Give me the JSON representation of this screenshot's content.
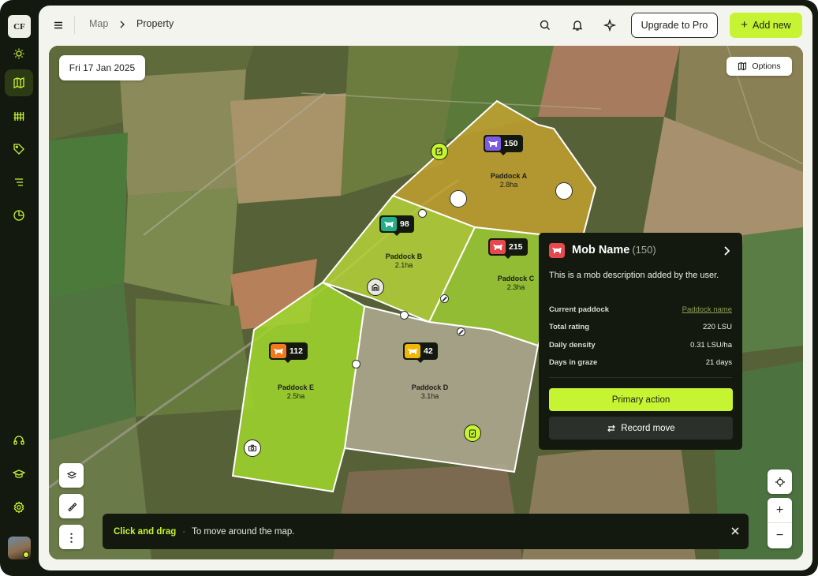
{
  "app": {
    "logo_text": "CF"
  },
  "sidebar": {
    "items": [
      {
        "name": "weather",
        "icon": "sun-icon"
      },
      {
        "name": "map",
        "icon": "map-icon",
        "active": true
      },
      {
        "name": "paddocks",
        "icon": "fence-icon"
      },
      {
        "name": "tags",
        "icon": "tag-icon"
      },
      {
        "name": "tasks",
        "icon": "list-icon"
      },
      {
        "name": "reports",
        "icon": "pie-chart-icon"
      },
      {
        "name": "support",
        "icon": "headset-icon"
      },
      {
        "name": "learn",
        "icon": "graduation-cap-icon"
      },
      {
        "name": "settings",
        "icon": "gear-icon"
      }
    ]
  },
  "header": {
    "breadcrumb": [
      "Map",
      "Property"
    ],
    "upgrade_label": "Upgrade to Pro",
    "add_label": "Add new",
    "icons": [
      "menu-icon",
      "search-icon",
      "bell-icon",
      "sparkle-icon"
    ]
  },
  "map": {
    "date": "Fri 17 Jan 2025",
    "options_label": "Options",
    "paddocks": [
      {
        "name": "Paddock A",
        "area": "2.8ha"
      },
      {
        "name": "Paddock B",
        "area": "2.1ha"
      },
      {
        "name": "Paddock C",
        "area": "2.3ha"
      },
      {
        "name": "Paddock D",
        "area": "3.1ha"
      },
      {
        "name": "Paddock E",
        "area": "2.5ha"
      }
    ],
    "mobs": [
      {
        "count": "150",
        "color": "#7c5ce0"
      },
      {
        "count": "98",
        "color": "#1fb08a"
      },
      {
        "count": "215",
        "color": "#e5484d"
      },
      {
        "count": "112",
        "color": "#f07a1c"
      },
      {
        "count": "42",
        "color": "#f2b705"
      }
    ]
  },
  "mob_panel": {
    "title": "Mob Name",
    "count": "(150)",
    "description": "This is a mob description added by the user.",
    "rows": [
      {
        "label": "Current paddock",
        "value": "Paddock name"
      },
      {
        "label": "Total rating",
        "value": "220 LSU"
      },
      {
        "label": "Daily density",
        "value": "0.31 LSU/ha"
      },
      {
        "label": "Days in graze",
        "value": "21 days"
      }
    ],
    "primary_label": "Primary action",
    "secondary_label": "Record move"
  },
  "toast": {
    "highlight": "Click and drag",
    "separator": "·",
    "message": "To move around the map."
  },
  "colors": {
    "accent": "#c6f432",
    "dark": "#14190f"
  }
}
